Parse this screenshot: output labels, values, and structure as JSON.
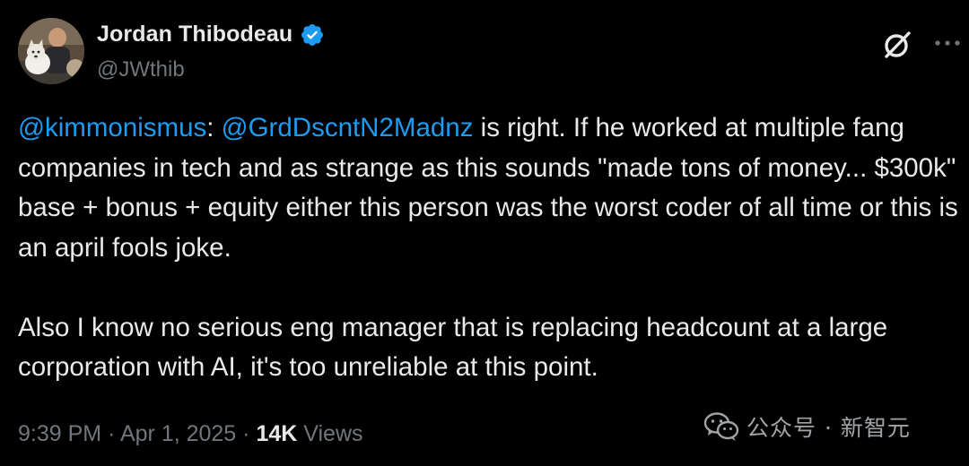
{
  "author": {
    "display_name": "Jordan Thibodeau",
    "handle": "@JWthib",
    "verified": true
  },
  "tweet": {
    "paragraph1": {
      "mention1": "@kimmonismus",
      "separator": ":  ",
      "mention2": "@GrdDscntN2Madnz",
      "text": " is right. If he worked at multiple fang companies in tech and as strange as this sounds \"made tons of money... $300k\" base + bonus + equity either this person was the worst coder of all time or this is an april fools joke."
    },
    "paragraph2": "Also I know no serious eng manager that is replacing headcount at a large corporation with AI, it's too unreliable at this point."
  },
  "meta": {
    "time": "9:39 PM",
    "dot1": " · ",
    "date": "Apr 1, 2025",
    "dot2": " · ",
    "views_count": "14K",
    "views_label": " Views"
  },
  "watermark": {
    "text": "公众号 · 新智元"
  },
  "icons": {
    "grok": "grok-icon",
    "more": "more-icon",
    "verified": "verified-badge-icon",
    "watermark": "wechat-icon"
  },
  "colors": {
    "background": "#000000",
    "text": "#e7e9ea",
    "secondary": "#71767b",
    "accent": "#1d9bf0"
  }
}
